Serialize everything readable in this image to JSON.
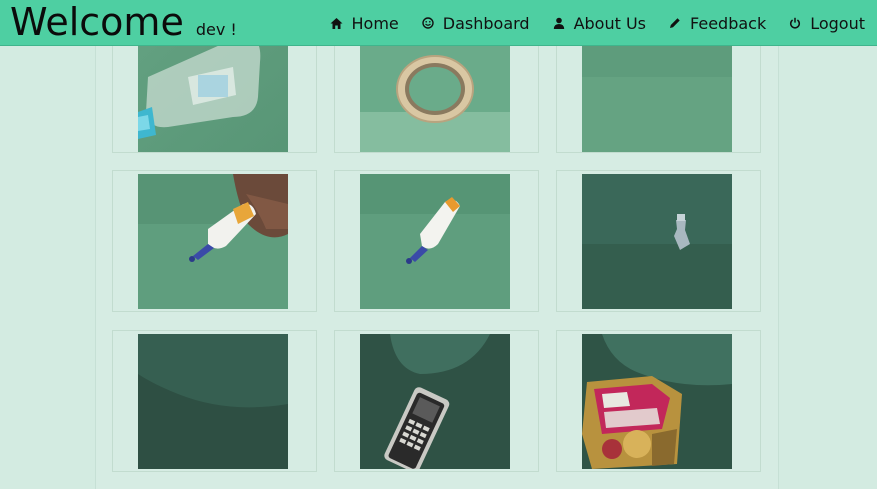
{
  "header": {
    "title": "Welcome",
    "user": "dev !"
  },
  "nav": {
    "items": [
      {
        "label": "Home",
        "icon": "home-icon"
      },
      {
        "label": "Dashboard",
        "icon": "dashboard-icon"
      },
      {
        "label": "About Us",
        "icon": "user-icon"
      },
      {
        "label": "Feedback",
        "icon": "pencil-icon"
      },
      {
        "label": "Logout",
        "icon": "power-icon"
      }
    ]
  },
  "gallery": {
    "images": [
      {
        "subject": "plastic bottle"
      },
      {
        "subject": "tape roll"
      },
      {
        "subject": "green cloth"
      },
      {
        "subject": "glue bottle in hand"
      },
      {
        "subject": "glue bottle"
      },
      {
        "subject": "small bottle"
      },
      {
        "subject": "dark cloth"
      },
      {
        "subject": "mobile phone"
      },
      {
        "subject": "snack wrapper"
      }
    ]
  },
  "colors": {
    "navbar": "#4ecfa2",
    "page_bg": "#d3ebe1",
    "cloth_green": "#5e9c7c"
  }
}
